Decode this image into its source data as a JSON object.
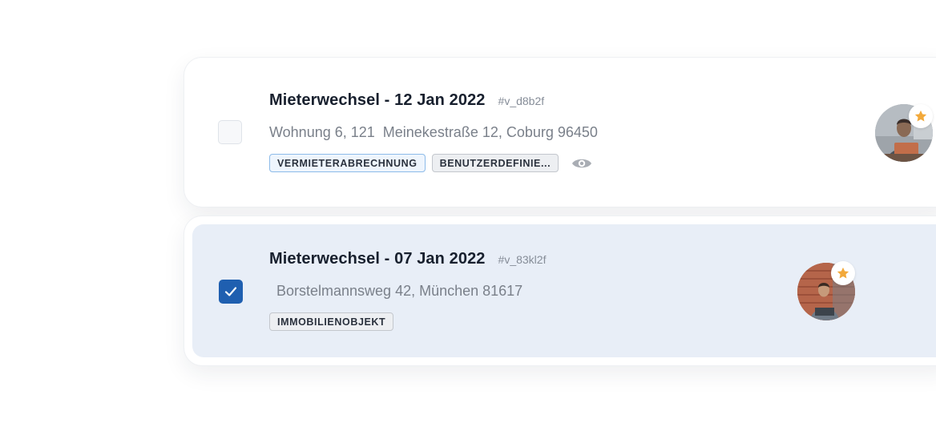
{
  "items": [
    {
      "title": "Mieterwechsel - 12 Jan 2022",
      "id": "#v_d8b2f",
      "address": "Wohnung 6, 121  Meinekestraße 12, Coburg 96450",
      "checked": false,
      "tags": [
        {
          "label": "VERMIETERABRECHNUNG",
          "style": "blue"
        },
        {
          "label": "BENUTZERDEFINIE...",
          "style": "gray"
        }
      ],
      "visibility_icon": "eye-icon",
      "avatar_icon": "avatar-person-laptop",
      "badge_icon": "star-icon"
    },
    {
      "title": "Mieterwechsel - 07 Jan 2022",
      "id": "#v_83kl2f",
      "address": "Borstelmannsweg 42, München 81617",
      "checked": true,
      "tags": [
        {
          "label": "IMMOBILIENOBJEKT",
          "style": "gray"
        }
      ],
      "avatar_icon": "avatar-person-brick-wall",
      "badge_icon": "star-icon"
    }
  ],
  "colors": {
    "selected_row_bg": "#e8eef7",
    "checkbox_checked": "#1f5fb0",
    "star": "#f2a93b",
    "tag_blue_border": "#8dbbe9"
  }
}
